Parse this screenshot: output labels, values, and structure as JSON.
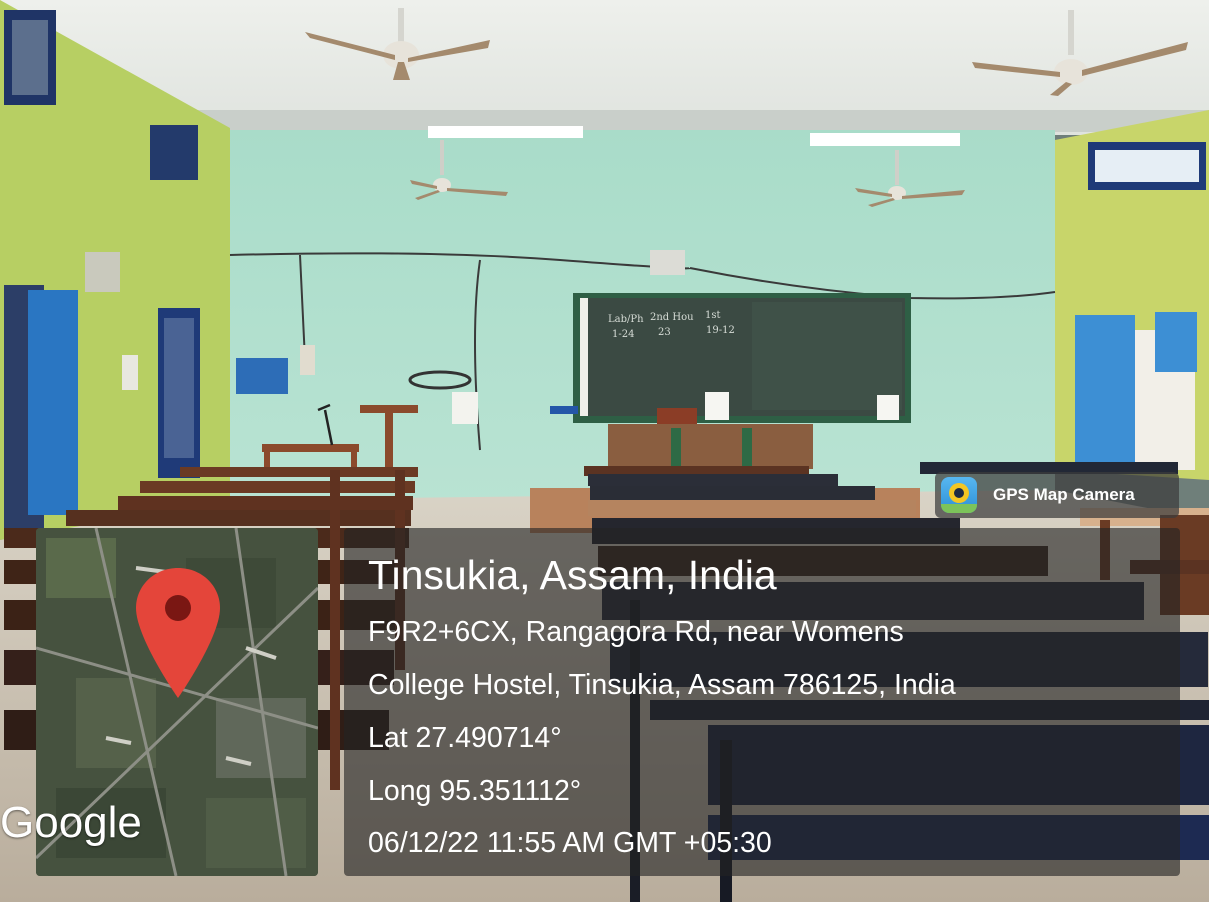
{
  "overlay": {
    "app_badge": {
      "icon": "gps-map-camera-icon",
      "label": "GPS Map Camera"
    },
    "map": {
      "logo_text": "Google",
      "pin_icon": "map-pin-icon",
      "pin_color": "#e4453a"
    },
    "location": {
      "title": "Tinsukia, Assam, India",
      "address_line1": "F9R2+6CX, Rangagora Rd, near Womens",
      "address_line2": "College Hostel, Tinsukia, Assam 786125, India",
      "latitude": "Lat 27.490714°",
      "longitude": "Long 95.351112°",
      "datetime": "06/12/22 11:55 AM GMT +05:30"
    }
  },
  "scene": {
    "chalkboard": {
      "text_a": "Lab/Ph",
      "text_b": "1-24",
      "text_c": "2nd Hou",
      "text_d": "23",
      "text_e": "1st",
      "text_f": "19-12"
    }
  }
}
